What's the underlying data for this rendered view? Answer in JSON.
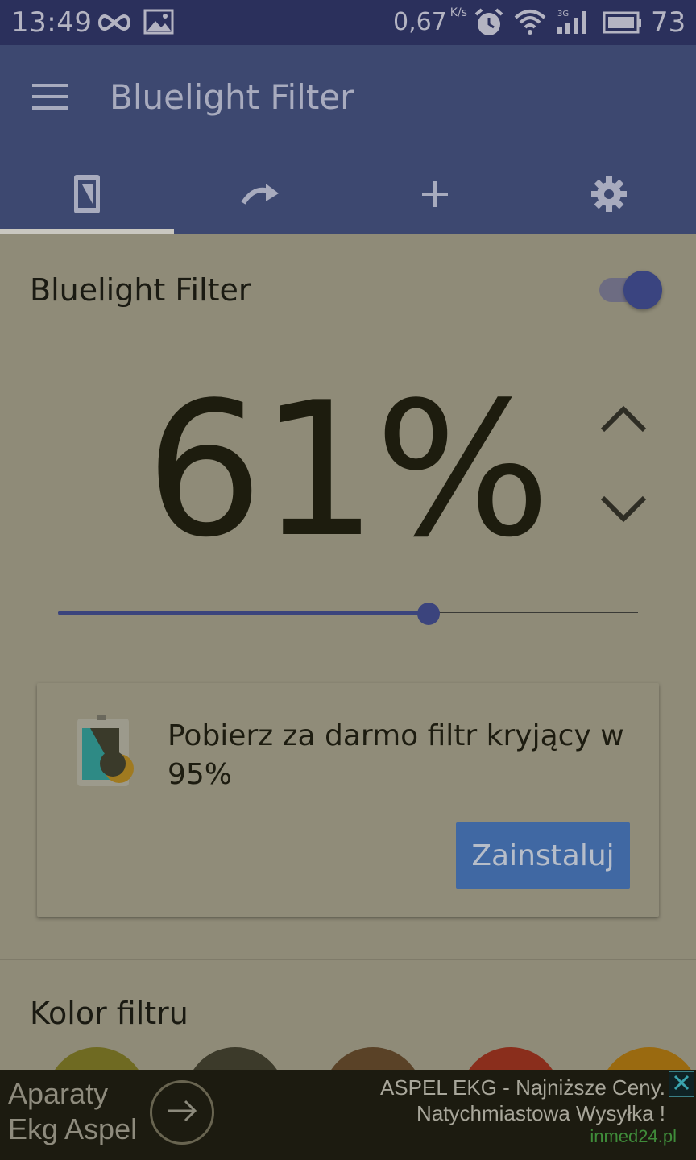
{
  "status_bar": {
    "time": "13:49",
    "speed": "0,67",
    "speed_unit": "K/s",
    "battery": "73",
    "icons": [
      "infinity-icon",
      "image-icon",
      "alarm-icon",
      "wifi-icon",
      "signal-3g-icon",
      "battery-icon"
    ]
  },
  "app_bar": {
    "title": "Bluelight Filter",
    "tabs": [
      {
        "name": "screen-filter",
        "icon": "phone-screen-icon",
        "selected": true
      },
      {
        "name": "schedule",
        "icon": "redo-arrow-icon",
        "selected": false
      },
      {
        "name": "add",
        "icon": "plus-icon",
        "selected": false
      },
      {
        "name": "settings",
        "icon": "gear-icon",
        "selected": false
      }
    ]
  },
  "filter": {
    "label": "Bluelight Filter",
    "enabled": true,
    "percent_text": "61%",
    "level": 0.61
  },
  "promo": {
    "text": "Pobierz za darmo filtr kryjący w 95%",
    "install_label": "Zainstaluj"
  },
  "color_section": {
    "title": "Kolor filtru",
    "swatches": [
      "#6f6a22",
      "#3c3a2a",
      "#5a4227",
      "#8a2e1c",
      "#9a6a10"
    ]
  },
  "ad": {
    "title_line1": "Aparaty",
    "title_line2": "Ekg Aspel",
    "desc_line1": "ASPEL EKG - Najniższe Ceny.",
    "desc_line2": "Natychmiastowa Wysyłka !",
    "domain": "inmed24.pl"
  },
  "colors": {
    "app_bar": "#3d4870",
    "status_bar": "#2b305c",
    "accent": "#3b447d",
    "install_button": "#4068a3",
    "background": "#8f8b78"
  }
}
